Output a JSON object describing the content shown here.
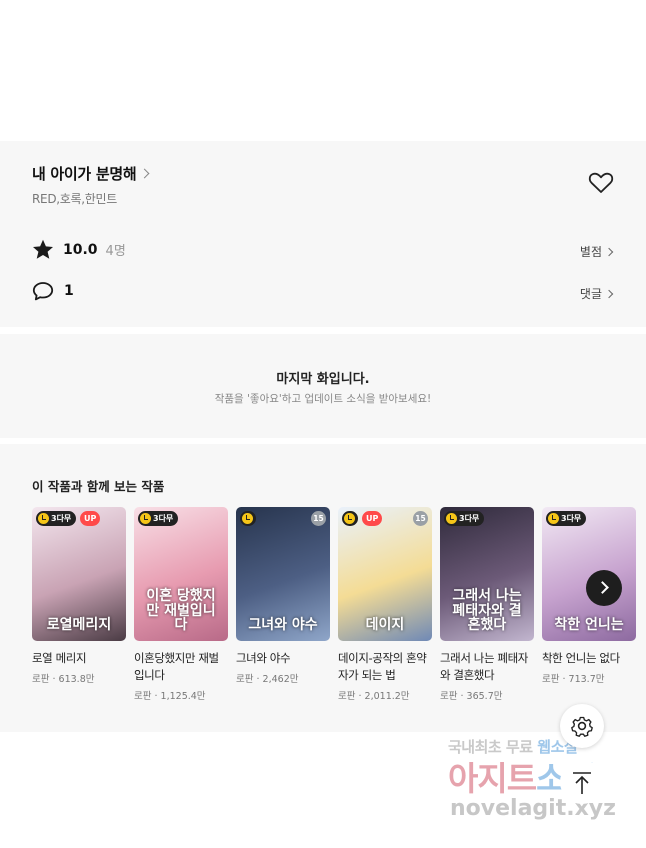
{
  "work": {
    "title": "내 아이가 분명해",
    "authors": "RED,호록,한민트",
    "rating_score": "10.0",
    "rating_count": "4명",
    "rating_link": "별점",
    "comment_count": "1",
    "comment_link": "댓글"
  },
  "last_episode": {
    "headline": "마지막 화입니다.",
    "subtext": "작품을 '좋아요'하고 업데이트 소식을 받아보세요!"
  },
  "recommendations": {
    "heading": "이 작품과 함께 보는 작품",
    "items": [
      {
        "title": "로열 메리지",
        "meta": "로판 · 613.8만",
        "badge": "3다무",
        "up": "UP",
        "age": "",
        "cover_text": "로열메리지",
        "colors": [
          "#f3e6ee",
          "#c9a3b4",
          "#4a3b44"
        ]
      },
      {
        "title": "이혼당했지만 재벌입니다",
        "meta": "로판 · 1,125.4만",
        "badge": "3다무",
        "up": "",
        "age": "",
        "cover_text": "이혼 당했지만 재벌입니다",
        "colors": [
          "#f8dfe6",
          "#e79bb0",
          "#b86a88"
        ]
      },
      {
        "title": "그녀와 야수",
        "meta": "로판 · 2,462만",
        "badge": "",
        "up": "",
        "age": "15",
        "cover_text": "그녀와 야수",
        "colors": [
          "#27344d",
          "#4d5f84",
          "#8fa6c9"
        ]
      },
      {
        "title": "데이지-공작의 혼약자가 되는 법",
        "meta": "로판 · 2,011.2만",
        "badge": "",
        "up": "UP",
        "age": "15",
        "cover_text": "데이지",
        "colors": [
          "#e9f1fb",
          "#f4dc95",
          "#6f89b6"
        ]
      },
      {
        "title": "그래서 나는 폐태자와 결혼했다",
        "meta": "로판 · 365.7만",
        "badge": "3다무",
        "up": "",
        "age": "",
        "cover_text": "그래서 나는 폐태자와 결혼했다",
        "colors": [
          "#2f2a3b",
          "#6c5a78",
          "#c2b6cf"
        ]
      },
      {
        "title": "착한 언니는 없다",
        "meta": "로판 · 713.7만",
        "badge": "3다무",
        "up": "",
        "age": "",
        "cover_text": "착한 언니는",
        "colors": [
          "#f2e9f4",
          "#c7a3cf",
          "#8d6aa0"
        ]
      }
    ]
  },
  "watermark": {
    "line1_gray": "국내최초 무료",
    "line1_blue": "웹소설",
    "line2_pink": "아지트",
    "line2_blue": "소설",
    "line3": "novelagit.xyz"
  },
  "icons": {
    "like": "heart-outline-icon",
    "rating": "star-icon",
    "comment": "speech-bubble-icon",
    "next": "chevron-right-icon",
    "settings": "gear-icon",
    "scroll_top": "arrow-up-icon",
    "free_wait": "clock-icon"
  }
}
